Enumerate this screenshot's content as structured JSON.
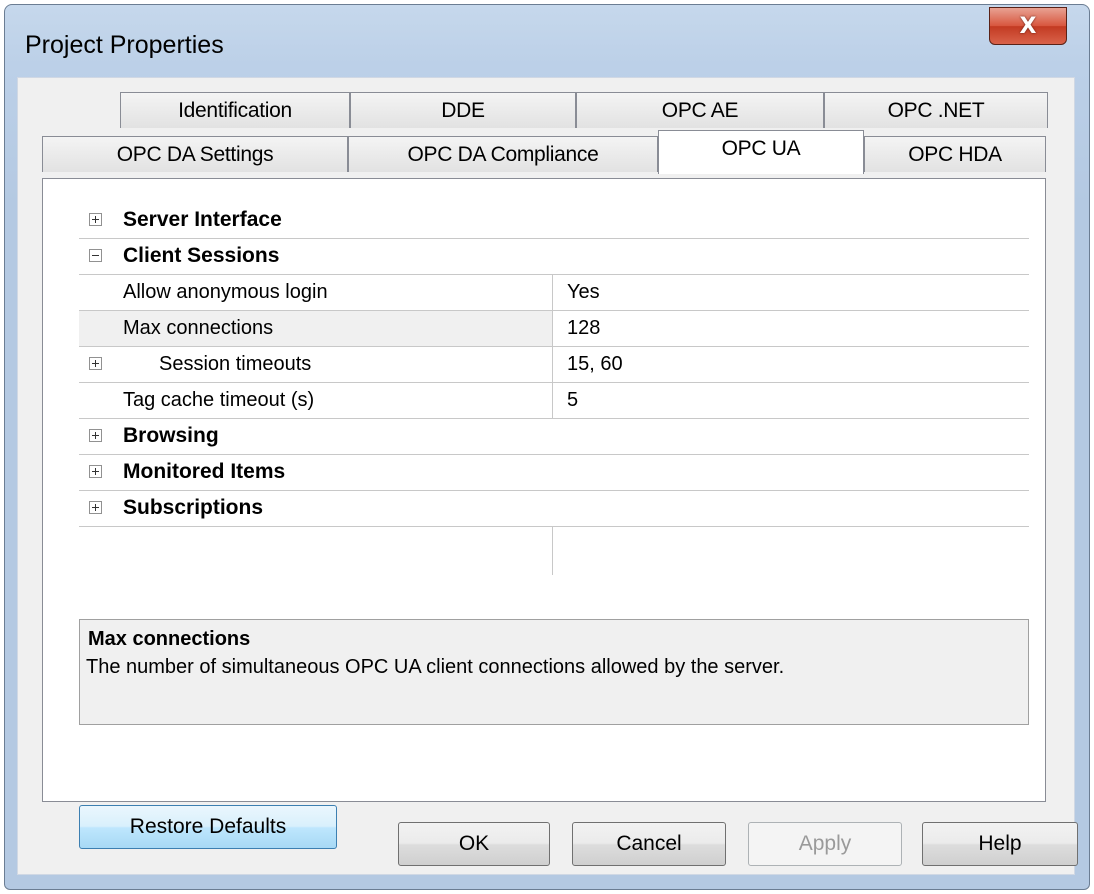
{
  "window": {
    "title": "Project Properties",
    "close_label": "X"
  },
  "tabs_row1": [
    "Identification",
    "DDE",
    "OPC AE",
    "OPC .NET"
  ],
  "tabs_row2": [
    "OPC DA Settings",
    "OPC DA Compliance",
    "OPC UA",
    "OPC HDA"
  ],
  "grid": {
    "server_interface": "Server Interface",
    "client_sessions": "Client Sessions",
    "props": [
      {
        "name": "Allow anonymous login",
        "value": "Yes"
      },
      {
        "name": "Max connections",
        "value": "128"
      },
      {
        "name": "Session timeouts",
        "value": "15, 60"
      },
      {
        "name": "Tag cache timeout (s)",
        "value": "5"
      }
    ],
    "browsing": "Browsing",
    "monitored_items": "Monitored Items",
    "subscriptions": "Subscriptions"
  },
  "description": {
    "title": "Max connections",
    "text": "The number of simultaneous OPC UA client connections allowed by the server."
  },
  "buttons": {
    "restore": "Restore Defaults",
    "ok": "OK",
    "cancel": "Cancel",
    "apply": "Apply",
    "help": "Help"
  }
}
